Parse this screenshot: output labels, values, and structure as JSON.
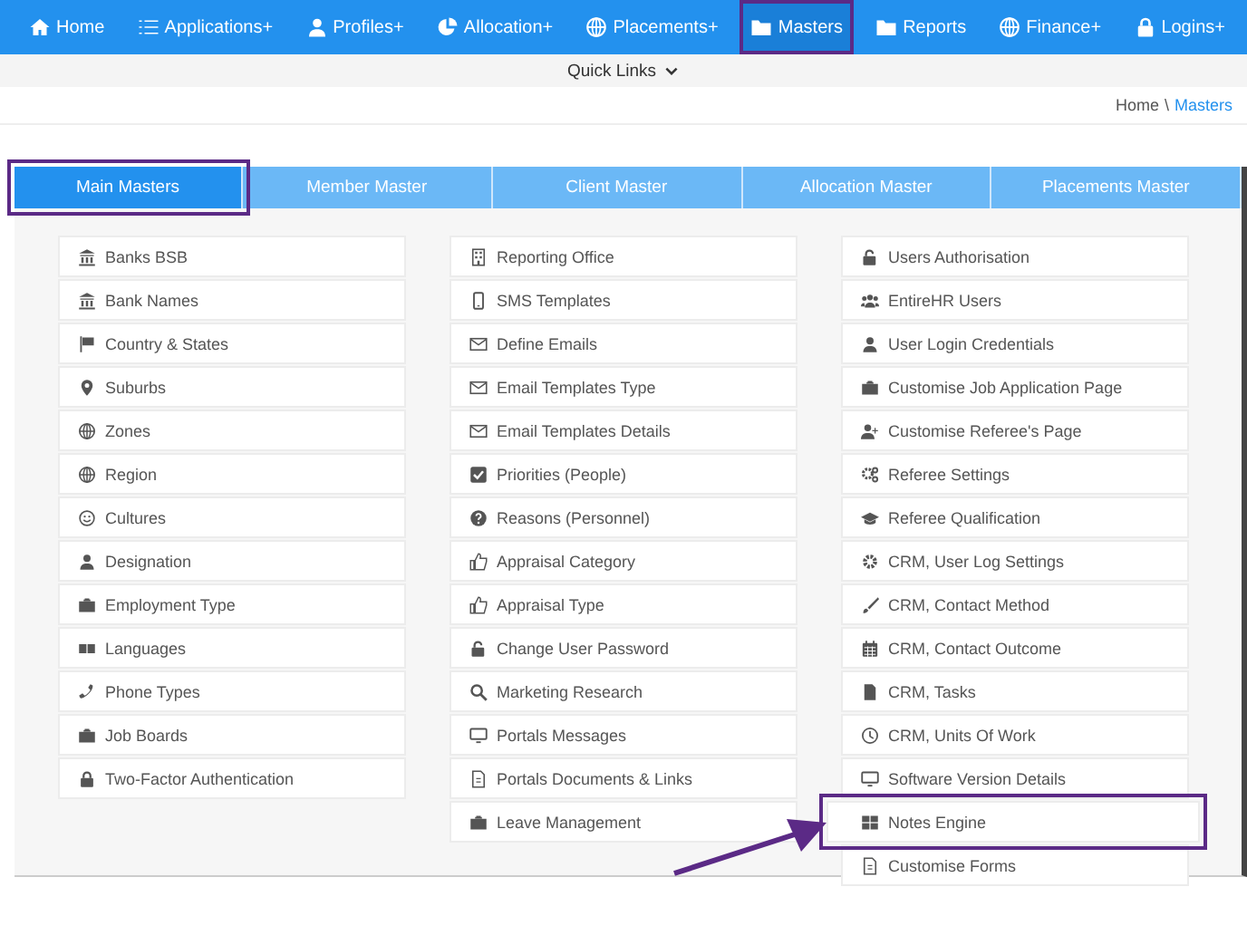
{
  "nav": [
    {
      "label": "Home",
      "selected": false,
      "highlighted": false
    },
    {
      "label": "Applications+",
      "selected": false,
      "highlighted": false
    },
    {
      "label": "Profiles+",
      "selected": false,
      "highlighted": false
    },
    {
      "label": "Allocation+",
      "selected": false,
      "highlighted": false
    },
    {
      "label": "Placements+",
      "selected": false,
      "highlighted": false
    },
    {
      "label": "Masters",
      "selected": true,
      "highlighted": true
    },
    {
      "label": "Reports",
      "selected": false,
      "highlighted": false
    },
    {
      "label": "Finance+",
      "selected": false,
      "highlighted": false
    },
    {
      "label": "Logins+",
      "selected": false,
      "highlighted": false
    }
  ],
  "quick_links": {
    "label": "Quick Links"
  },
  "breadcrumb": {
    "separator": "\\",
    "links": [
      {
        "label": "Home",
        "selected": false
      },
      {
        "label": "Masters",
        "selected": true
      }
    ]
  },
  "tabs": [
    {
      "label": "Main Masters",
      "selected": true,
      "highlighted": true
    },
    {
      "label": "Member Master",
      "selected": false,
      "highlighted": false
    },
    {
      "label": "Client Master",
      "selected": false,
      "highlighted": false
    },
    {
      "label": "Allocation Master",
      "selected": false,
      "highlighted": false
    },
    {
      "label": "Placements Master",
      "selected": false,
      "highlighted": false
    }
  ],
  "columns": [
    {
      "items": [
        {
          "label": "Banks BSB",
          "highlighted": false
        },
        {
          "label": "Bank Names",
          "highlighted": false
        },
        {
          "label": "Country & States",
          "highlighted": false
        },
        {
          "label": "Suburbs",
          "highlighted": false
        },
        {
          "label": "Zones",
          "highlighted": false
        },
        {
          "label": "Region",
          "highlighted": false
        },
        {
          "label": "Cultures",
          "highlighted": false
        },
        {
          "label": "Designation",
          "highlighted": false
        },
        {
          "label": "Employment Type",
          "highlighted": false
        },
        {
          "label": "Languages",
          "highlighted": false
        },
        {
          "label": "Phone Types",
          "highlighted": false
        },
        {
          "label": "Job Boards",
          "highlighted": false
        },
        {
          "label": "Two-Factor Authentication",
          "highlighted": false
        }
      ]
    },
    {
      "items": [
        {
          "label": "Reporting Office",
          "highlighted": false
        },
        {
          "label": "SMS Templates",
          "highlighted": false
        },
        {
          "label": "Define Emails",
          "highlighted": false
        },
        {
          "label": "Email Templates Type",
          "highlighted": false
        },
        {
          "label": "Email Templates Details",
          "highlighted": false
        },
        {
          "label": "Priorities (People)",
          "highlighted": false
        },
        {
          "label": "Reasons (Personnel)",
          "highlighted": false
        },
        {
          "label": "Appraisal Category",
          "highlighted": false
        },
        {
          "label": "Appraisal Type",
          "highlighted": false
        },
        {
          "label": "Change User Password",
          "highlighted": false
        },
        {
          "label": "Marketing Research",
          "highlighted": false
        },
        {
          "label": "Portals Messages",
          "highlighted": false
        },
        {
          "label": "Portals Documents & Links",
          "highlighted": false
        },
        {
          "label": "Leave Management",
          "highlighted": false
        }
      ]
    },
    {
      "items": [
        {
          "label": "Users Authorisation",
          "highlighted": false
        },
        {
          "label": "EntireHR Users",
          "highlighted": false
        },
        {
          "label": "User Login Credentials",
          "highlighted": false
        },
        {
          "label": "Customise Job Application Page",
          "highlighted": false
        },
        {
          "label": "Customise Referee's Page",
          "highlighted": false
        },
        {
          "label": "Referee Settings",
          "highlighted": false
        },
        {
          "label": "Referee Qualification",
          "highlighted": false
        },
        {
          "label": "CRM, User Log Settings",
          "highlighted": false
        },
        {
          "label": "CRM, Contact Method",
          "highlighted": false
        },
        {
          "label": "CRM, Contact Outcome",
          "highlighted": false
        },
        {
          "label": "CRM, Tasks",
          "highlighted": false
        },
        {
          "label": "CRM, Units Of Work",
          "highlighted": false
        },
        {
          "label": "Software Version Details",
          "highlighted": false
        },
        {
          "label": "Notes Engine",
          "highlighted": true
        },
        {
          "label": "Customise Forms",
          "highlighted": false
        }
      ]
    }
  ]
}
